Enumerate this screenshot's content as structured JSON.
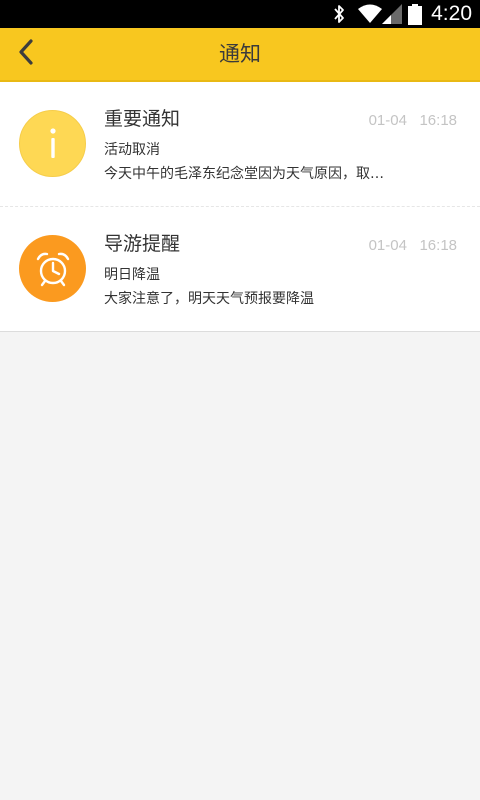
{
  "status_bar": {
    "time": "4:20",
    "icons": [
      "bluetooth-icon",
      "wifi-icon",
      "signal-icon",
      "battery-icon"
    ]
  },
  "header": {
    "title": "通知",
    "back_icon": "chevron-left-icon",
    "background": "#f8c71f"
  },
  "notifications": [
    {
      "icon": "info-icon",
      "icon_color": "#fed854",
      "title": "重要通知",
      "time": "01-04   16:18",
      "subtitle": "活动取消",
      "body": "今天中午的毛泽东纪念堂因为天气原因，取…"
    },
    {
      "icon": "alarm-clock-icon",
      "icon_color": "#fb9a1f",
      "title": "导游提醒",
      "time": "01-04   16:18",
      "subtitle": "明日降温",
      "body": "大家注意了，明天天气预报要降温"
    }
  ]
}
